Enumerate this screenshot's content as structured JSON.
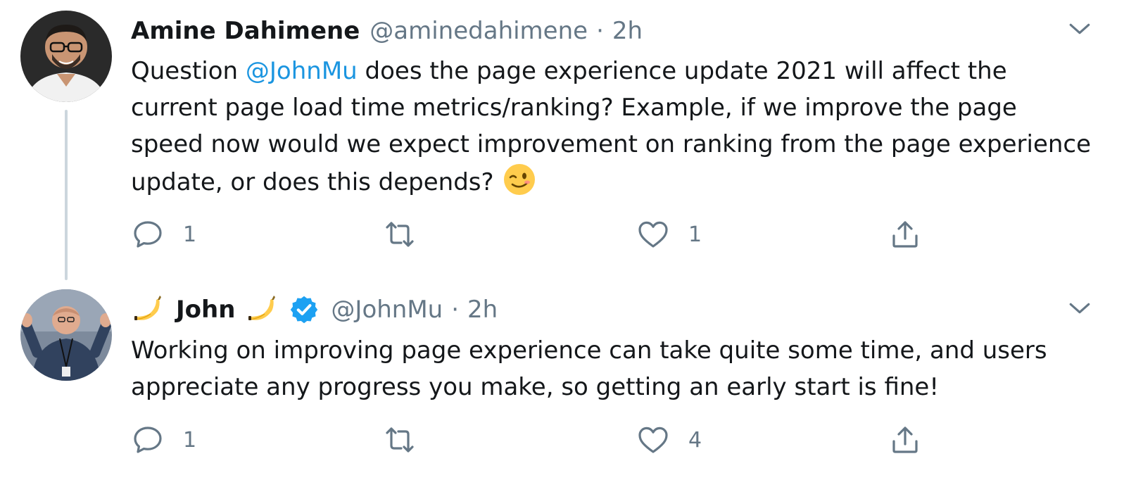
{
  "tweets": [
    {
      "author_name": "Amine Dahimene",
      "handle": "@aminedahimene",
      "separator": "·",
      "time": "2h",
      "text_segments": {
        "before_mention": "Question ",
        "mention": "@JohnMu",
        "after_mention": " does the page experience update 2021 will affect the current page load time metrics/ranking? Example, if we improve the page speed now would we expect improvement on ranking from the page experience update, or does this depends?"
      },
      "emoji": "winking-face",
      "avatar": "avatar-amine-dahimene",
      "actions": {
        "reply_count": "1",
        "retweet_count": "",
        "like_count": "1"
      }
    },
    {
      "author_name": "John",
      "name_emoji": "banana",
      "verified": true,
      "handle": "@JohnMu",
      "separator": "·",
      "time": "2h",
      "text": "Working on improving page experience can take quite some time, and users appreciate any progress you make, so getting an early start is fine!",
      "avatar": "avatar-john-mueller",
      "actions": {
        "reply_count": "1",
        "retweet_count": "",
        "like_count": "4"
      }
    }
  ],
  "icons": {
    "reply": "reply-icon",
    "retweet": "retweet-icon",
    "like": "heart-icon",
    "share": "share-icon",
    "more": "chevron-down-icon",
    "verified": "verified-badge-icon"
  },
  "colors": {
    "text": "#14171a",
    "secondary": "#657786",
    "link": "#1b95e0",
    "verified": "#1da1f2",
    "thread_line": "#ccd6dd"
  }
}
